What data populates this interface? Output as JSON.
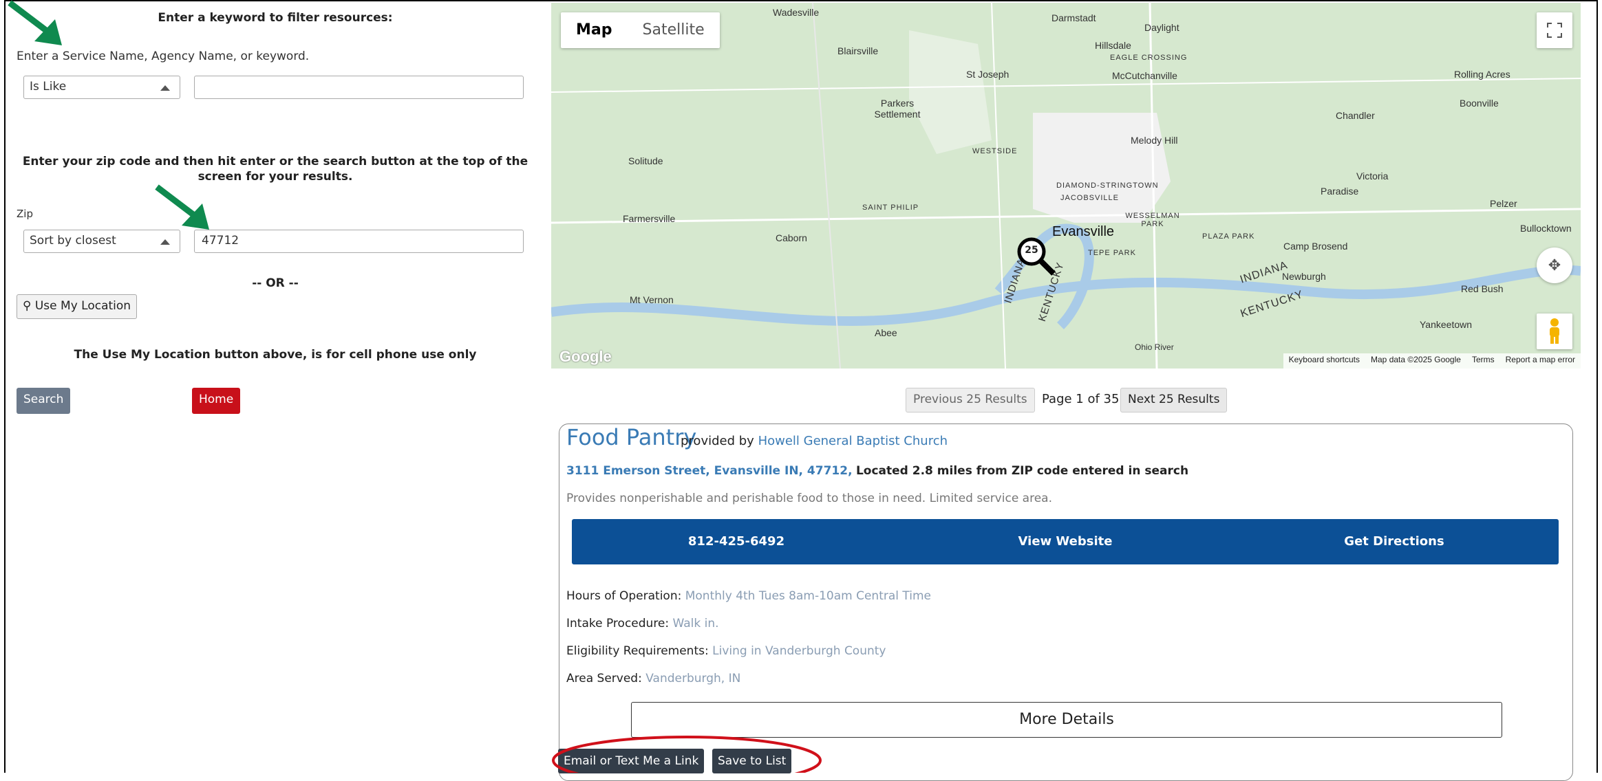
{
  "left": {
    "keyword_title": "Enter a keyword to filter resources:",
    "keyword_help": "Enter a Service Name, Agency Name, or keyword.",
    "match_select": "Is Like",
    "keyword_value": "",
    "zip_title": "Enter your zip code and then hit enter or the search button at the top of the screen for your results.",
    "zip_label": "Zip",
    "sort_select": "Sort by closest",
    "zip_value": "47712",
    "or_text": "-- OR --",
    "use_location": "Use My Location",
    "location_note": "The Use My Location button above, is for cell phone use only",
    "search_btn": "Search",
    "home_btn": "Home",
    "colors": {
      "search": "#6c7a8c",
      "home": "#c8101a",
      "arrow": "#0f8a4f"
    }
  },
  "map": {
    "tab_map": "Map",
    "tab_satellite": "Satellite",
    "marker_count": "25",
    "places": [
      "Wadesville",
      "Darmstadt",
      "Daylight",
      "Hillsdale",
      "EAGLE CROSSING",
      "McCutchanville",
      "Rolling Acres",
      "Blairsville",
      "St Joseph",
      "Boonville",
      "Parkers Settlement",
      "Chandler",
      "Melody Hill",
      "WESTSIDE",
      "Solitude",
      "Victoria",
      "DIAMOND-STRINGTOWN",
      "JACOBSVILLE",
      "Paradise",
      "Pelzer",
      "Farmersville",
      "SAINT PHILIP",
      "WESSELMAN PARK",
      "Bullocktown",
      "Evansville",
      "PLAZA PARK",
      "Camp Brosend",
      "Caborn",
      "TEPE PARK",
      "INDIANA",
      "Newburgh",
      "Red Bush",
      "Mt Vernon",
      "KENTUCKY",
      "Yankeetown",
      "Abee",
      "Ohio River",
      "INDIANA",
      "KENTUCKY"
    ],
    "logo": "Google",
    "attribution": [
      "Keyboard shortcuts",
      "Map data ©2025 Google",
      "Terms",
      "Report a map error"
    ]
  },
  "pager": {
    "prev": "Previous 25 Results",
    "page": "Page 1 of 35",
    "next": "Next 25 Results"
  },
  "result": {
    "title": "Food Pantry",
    "provided_by": "provided by",
    "agency": "Howell General Baptist Church",
    "address": "3111 Emerson Street, Evansville IN, 47712,",
    "distance": "Located 2.8 miles from ZIP code entered in search",
    "description": "Provides nonperishable and perishable food to those in need. Limited service area.",
    "phone": "812-425-6492",
    "website": "View Website",
    "directions": "Get Directions",
    "hours_label": "Hours of Operation:",
    "hours": "Monthly 4th Tues 8am-10am Central Time",
    "intake_label": "Intake Procedure:",
    "intake": "Walk in.",
    "elig_label": "Eligibility Requirements:",
    "elig": "Living in Vanderburgh County",
    "area_label": "Area Served:",
    "area": "Vanderburgh, IN",
    "more_details": "More Details",
    "email_btn": "Email or Text Me a Link",
    "save_btn": "Save to List"
  }
}
